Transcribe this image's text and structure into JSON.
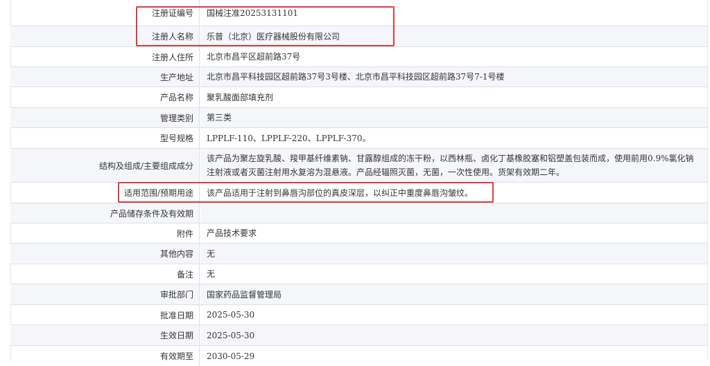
{
  "rows": [
    {
      "label": "注册证编号",
      "value": "国械注准20253131101"
    },
    {
      "label": "注册人名称",
      "value": "乐普（北京）医疗器械股份有限公司"
    },
    {
      "label": "注册人住所",
      "value": "北京市昌平区超前路37号"
    },
    {
      "label": "生产地址",
      "value": "北京市昌平科技园区超前路37号3号楼、北京市昌平科技园区超前路37号7-1号楼"
    },
    {
      "label": "产品名称",
      "value": "聚乳酸面部填充剂"
    },
    {
      "label": "管理类别",
      "value": "第三类"
    },
    {
      "label": "型号规格",
      "value": "LPPLF-110、LPPLF-220、LPPLF-370。"
    },
    {
      "label": "结构及组成/主要组成成分",
      "value": "该产品为聚左旋乳酸、羧甲基纤维素钠、甘露醇组成的冻干粉，以西林瓶、卤化丁基橡胶塞和铝塑盖包装而成，使用前用0.9%氯化钠注射液或者灭菌注射用水复溶为混悬液。产品经辐照灭菌，无菌，一次性使用。货架有效期二年。"
    },
    {
      "label": "适用范围/预期用途",
      "value": "该产品适用于注射到鼻唇沟部位的真皮深层，以纠正中重度鼻唇沟皱纹。"
    },
    {
      "label": "产品储存条件及有效期",
      "value": ""
    },
    {
      "label": "附件",
      "value": "产品技术要求"
    },
    {
      "label": "其他内容",
      "value": "无"
    },
    {
      "label": "备注",
      "value": "无"
    },
    {
      "label": "审批部门",
      "value": "国家药品监督管理局"
    },
    {
      "label": "批准日期",
      "value": "2025-05-30"
    },
    {
      "label": "生效日期",
      "value": "2025-05-30"
    },
    {
      "label": "有效期至",
      "value": "2030-05-29"
    }
  ],
  "highlight_color": "#e23a3f"
}
